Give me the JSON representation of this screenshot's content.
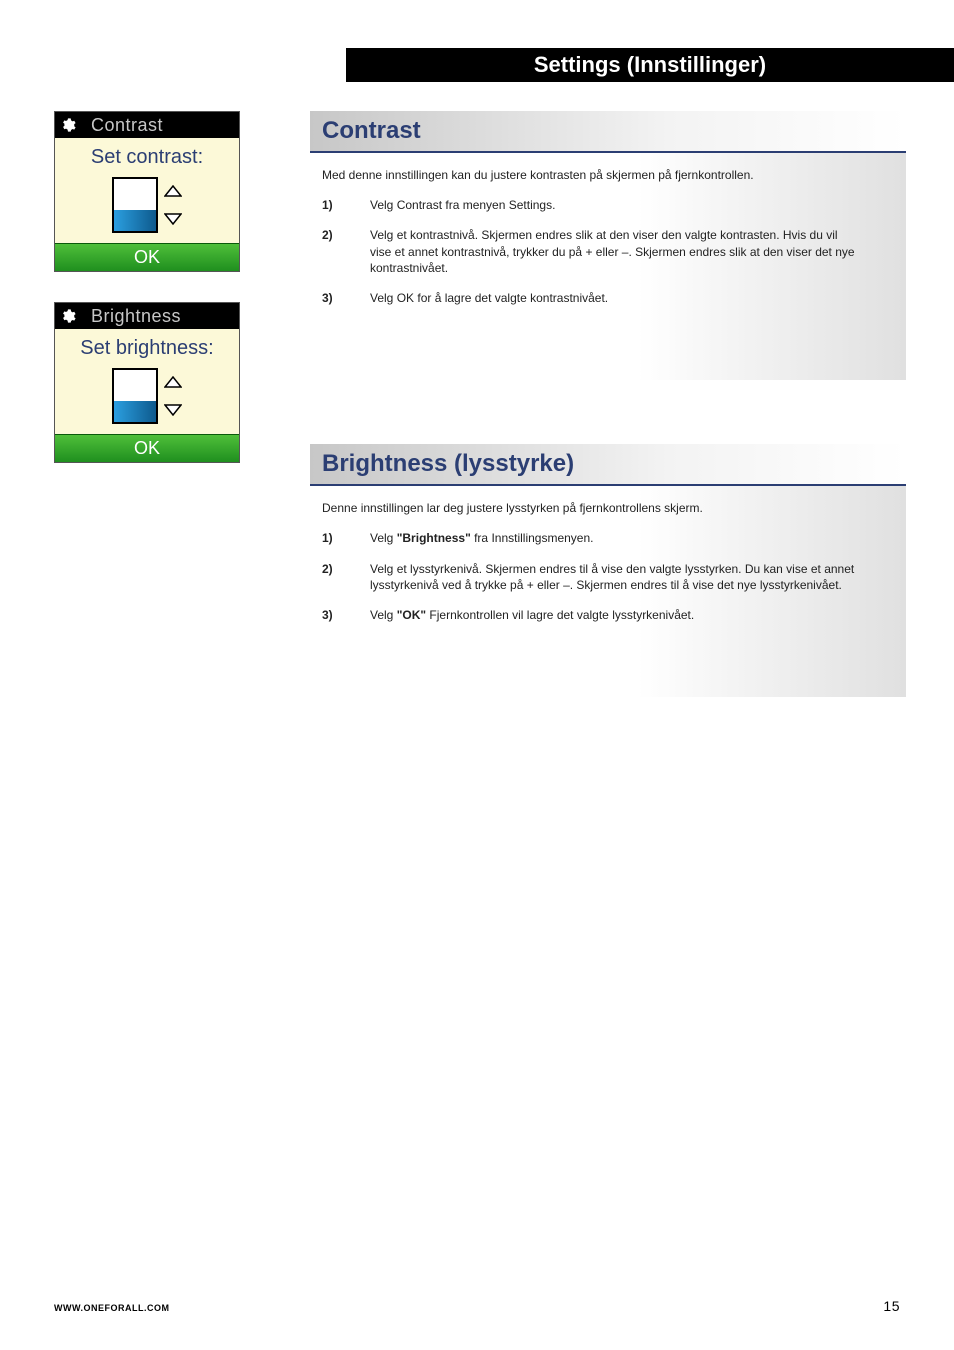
{
  "header": {
    "title": "Settings (Innstillinger)"
  },
  "sidebar": {
    "panels": [
      {
        "title": "Contrast",
        "prompt": "Set contrast:",
        "ok": "OK"
      },
      {
        "title": "Brightness",
        "prompt": "Set brightness:",
        "ok": "OK"
      }
    ]
  },
  "sections": [
    {
      "heading": "Contrast",
      "intro": "Med denne innstillingen kan du justere kontrasten på skjermen på fjernkontrollen.",
      "steps": [
        {
          "num": "1)",
          "text": "Velg Contrast fra menyen Settings."
        },
        {
          "num": "2)",
          "text": "Velg et kontrastnivå. Skjermen endres slik at den viser den valgte kontrasten. Hvis du vil vise et annet kontrastnivå, trykker du på + eller –. Skjermen endres slik at den viser det nye kontrastnivået."
        },
        {
          "num": "3)",
          "text": "Velg OK for å lagre det valgte kontrastnivået."
        }
      ]
    },
    {
      "heading": "Brightness (lysstyrke)",
      "intro": "Denne innstillingen lar deg justere lysstyrken på fjernkontrollens skjerm.",
      "steps": [
        {
          "num": "1)",
          "pre": "Velg ",
          "bold": "\"Brightness\"",
          "post": " fra Innstillingsmenyen."
        },
        {
          "num": "2)",
          "text": "Velg et lysstyrkenivå. Skjermen endres til å vise den valgte lysstyrken. Du kan vise et annet lysstyrkenivå ved å trykke på + eller –. Skjermen endres til å vise det nye lysstyrkenivået."
        },
        {
          "num": "3)",
          "pre": "Velg ",
          "bold": "\"OK\"",
          "post": " Fjernkontrollen vil lagre det valgte lysstyrkenivået."
        }
      ]
    }
  ],
  "footer": {
    "url": "WWW.ONEFORALL.COM",
    "page": "15"
  }
}
